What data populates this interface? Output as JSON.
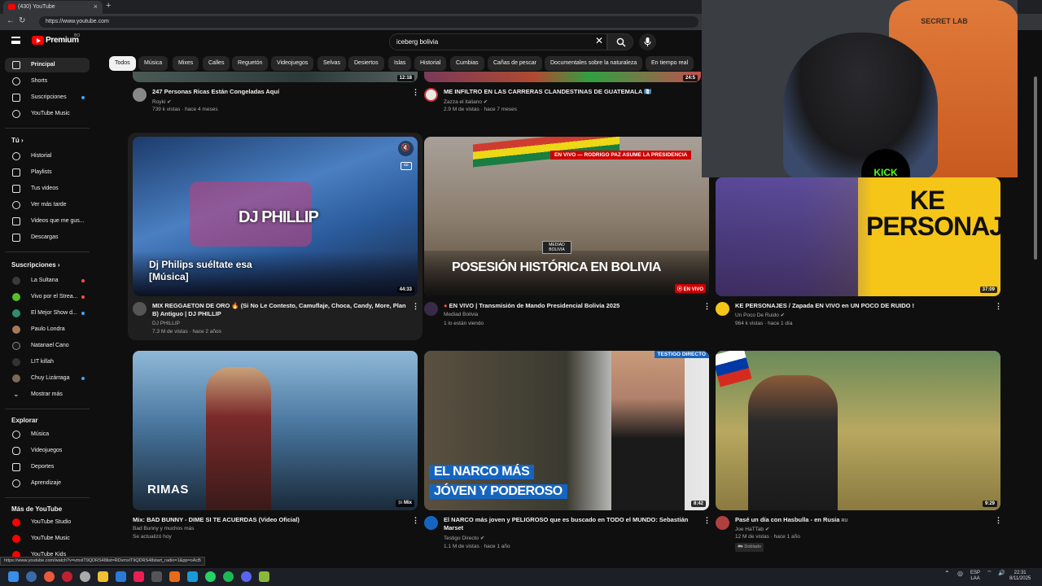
{
  "browser": {
    "tab_title": "(430) YouTube",
    "url": "https://www.youtube.com",
    "status_url": "https://www.youtube.com/watch?v=vmxlT9QDRS48list=RDvmxlT9QDRS48start_radio=1&pp=oAcB"
  },
  "header": {
    "logo_text": "Premium",
    "logo_sup": "BO",
    "search_value": "iceberg bolivia"
  },
  "chips": [
    "Todos",
    "Música",
    "Mixes",
    "Calles",
    "Reguetón",
    "Videojuegos",
    "Selvas",
    "Desiertos",
    "Islas",
    "Historial",
    "Cumbias",
    "Cañas de pescar",
    "Documentales sobre la naturaleza",
    "En tiempo real"
  ],
  "sidebar": {
    "main": [
      "Principal",
      "Shorts",
      "Suscripciones",
      "YouTube Music"
    ],
    "you_header": "Tú",
    "you": [
      "Historial",
      "Playlists",
      "Tus videos",
      "Ver más tarde",
      "Videos que me gus..."
    ],
    "downloads": "Descargas",
    "subs_header": "Suscripciones",
    "subs": [
      "La Sultana",
      "Vivo por el Strea...",
      "El Mejor Show d...",
      "Paulo Londra",
      "Natanael Cano",
      "LIT killah",
      "Chuy Lizárraga"
    ],
    "show_more": "Mostrar más",
    "explore_header": "Explorar",
    "explore": [
      "Música",
      "Videojuegos",
      "Deportes",
      "Aprendizaje"
    ],
    "more_header": "Más de YouTube",
    "more": [
      "YouTube Studio",
      "YouTube Music",
      "YouTube Kids"
    ]
  },
  "videos": {
    "top1": {
      "title": "247 Personas Ricas Están Congeladas Aquí",
      "channel": "Royki",
      "meta": "739 k vistas · hace 4 meses",
      "duration": "12:18"
    },
    "top2": {
      "title": "ME INFILTRO EN LAS CARRERAS CLANDESTINAS DE GUATEMALA 🇬🇹",
      "channel": "Zazza el italiano",
      "meta": "2.9 M de vistas · hace 7 meses",
      "duration": "24:5"
    },
    "v1": {
      "title": "MIX REGGAETON DE ORO 🔥 (Si No Le Contesto, Camuflaje, Choca, Candy, More, Plan B) Antiguo | DJ PHILLIP",
      "channel": "DJ PHILLIP",
      "meta": "7.3 M de vistas · hace 2 años",
      "duration": "44:33",
      "overlay": "Dj Philips suéltate esa [Música]",
      "logo": "DJ PHILLIP"
    },
    "v2": {
      "title": "EN VIVO | Transmisión de Mando Presidencial Bolivia 2025",
      "channel": "Mediad Bolivia",
      "meta": "1 lo están viendo",
      "badge": "EN VIVO",
      "banner": "EN VIVO — RODRIGO PAZ ASUME LA PRESIDENCIA",
      "overlay": "POSESIÓN HISTÓRICA EN BOLIVIA",
      "brand": "MEDIAD BOLIVIA"
    },
    "v3": {
      "title": "KE PERSONAJES / Zapada EN VIVO en UN POCO DE RUIDO !",
      "channel": "Un Poco De Ruido",
      "meta": "964 k vistas · hace 1 día",
      "duration": "37:09",
      "overlay": "KE PERSONAJES"
    },
    "v4": {
      "title": "Mix: BAD BUNNY - DIME SI TE ACUERDAS (Video Oficial)",
      "channel": "Bad Bunny y muchos más",
      "meta": "Se actualizó hoy",
      "badge": "Mix",
      "overlay": "RIMAS"
    },
    "v5": {
      "title": "El NARCO más joven y PELIGROSO que es buscado en TODO el MUNDO: Sebastián Marset",
      "channel": "Testigo Directo",
      "meta": "1.1 M de vistas · hace 1 año",
      "duration": "8:42",
      "overlay1": "EL NARCO MÁS",
      "overlay2": "JÓVEN Y PODEROSO",
      "brand": "TESTIGO DIRECTO"
    },
    "v6": {
      "title": "Pasé un día con Hasbulla - en Rusia",
      "title_suffix": "RU",
      "channel": "Joe HaTTab",
      "meta": "12 M de vistas · hace 1 año",
      "duration": "9:29",
      "dub": "Doblado"
    }
  },
  "webcam": {
    "brand": "SECRET LAB",
    "kick": "KICK"
  },
  "taskbar": {
    "lang1": "ESP",
    "lang2": "LAA",
    "time": "22:31",
    "date": "8/11/2025"
  }
}
